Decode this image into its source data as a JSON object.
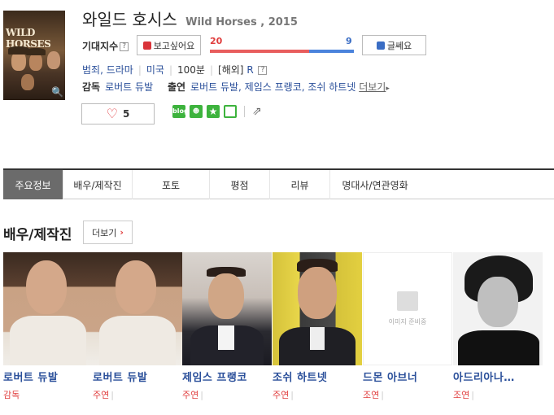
{
  "movie": {
    "title_ko": "와일드 호시스",
    "title_en": "Wild Horses , 2015",
    "poster_text": "WILD HORSES"
  },
  "expect": {
    "label": "기대지수",
    "help": "?",
    "want_label": "보고싶어요",
    "want_count": "20",
    "dislike_label": "글쎄요",
    "dislike_count": "9",
    "want_ratio": 0.69
  },
  "meta": {
    "genre": "범죄, 드라마",
    "country": "미국",
    "runtime": "100분",
    "rating_prefix": "[해외]",
    "rating": "R",
    "rating_help": "?"
  },
  "crew": {
    "director_label": "감독",
    "director": "로버트 듀발",
    "cast_label": "출연",
    "cast": "로버트 듀발, 제임스 프랭코, 조쉬 하트넷",
    "more": "더보기"
  },
  "likes": {
    "count": "5"
  },
  "share_icons": [
    "blog",
    "me2day",
    "star",
    "facebook"
  ],
  "tabs": [
    "주요정보",
    "배우/제작진",
    "포토",
    "평점",
    "리뷰",
    "명대사/연관영화"
  ],
  "section": {
    "title": "배우/제작진",
    "more": "더보기"
  },
  "people": [
    {
      "name": "로버트 듀발",
      "role": "감독"
    },
    {
      "name": "로버트 듀발",
      "role": "주연"
    },
    {
      "name": "제임스 프랭코",
      "role": "주연"
    },
    {
      "name": "조쉬 하트넷",
      "role": "주연"
    },
    {
      "name": "드몬 아브너",
      "role": "조연",
      "no_image": "이미지 준비중"
    },
    {
      "name": "아드리아나…",
      "role": "조연"
    }
  ],
  "colors": {
    "accent_red": "#e03d3d",
    "accent_blue": "#3a6dc4",
    "link_blue": "#2a4f9a",
    "active_tab": "#6b6b6b"
  }
}
